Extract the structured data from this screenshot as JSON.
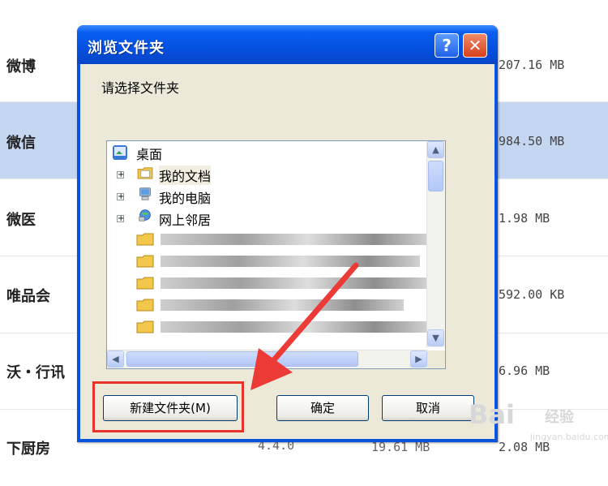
{
  "background": {
    "rows": [
      {
        "name": "微博",
        "size": "207.16 MB"
      },
      {
        "name": "微信",
        "size": "984.50 MB"
      },
      {
        "name": "微医",
        "size": "1.98 MB"
      },
      {
        "name": "唯品会",
        "size": "592.00 KB"
      },
      {
        "name": "沃・行讯",
        "size": "6.96 MB"
      },
      {
        "name": "下厨房",
        "version": "4.4.0",
        "size_mid": "19.61 MB",
        "size": "2.08 MB"
      }
    ]
  },
  "dialog": {
    "title": "浏览文件夹",
    "help_glyph": "?",
    "close_glyph": "✕",
    "prompt": "请选择文件夹",
    "tree": {
      "root": "桌面",
      "items": [
        "我的文档",
        "我的电脑",
        "网上邻居"
      ]
    },
    "buttons": {
      "new_folder": "新建文件夹(M)",
      "ok": "确定",
      "cancel": "取消"
    }
  },
  "watermark": {
    "brand": "Bai",
    "brand2": "经验",
    "url": "jingyan.baidu.com"
  },
  "colors": {
    "titlebar": "#0450e0",
    "selected_row": "#c5d6f1",
    "annotation": "#e8332c"
  }
}
